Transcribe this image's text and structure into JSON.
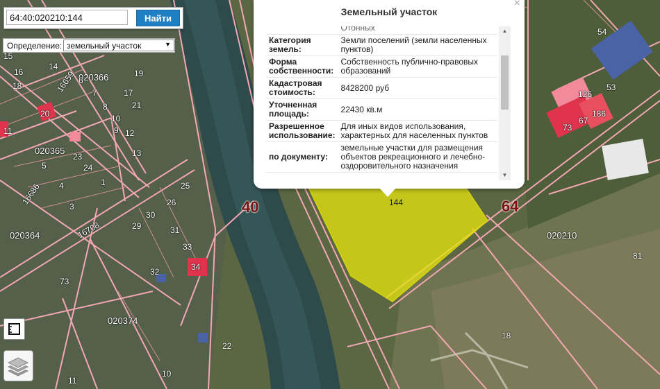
{
  "search": {
    "value": "64:40:020210:144",
    "button_label": "Найти"
  },
  "definition": {
    "label": "Определение:",
    "selected": "земельный участок"
  },
  "popup": {
    "title": "Земельный участок",
    "close": "×",
    "truncated_top": "Отонных",
    "rows": [
      {
        "key": "Категория земель:",
        "value": "Земли поселений (земли населенных пунктов)"
      },
      {
        "key": "Форма собственности:",
        "value": "Собственность публично-правовых образований"
      },
      {
        "key": "Кадастровая стоимость:",
        "value": "8428200 руб"
      },
      {
        "key": "Уточненная площадь:",
        "value": "22430 кв.м"
      },
      {
        "key": "Разрешенное использование:",
        "value": "Для иных видов использования, характерных для населенных пунктов"
      },
      {
        "key": "по документу:",
        "value": "земельные участки для размещения объектов рекреационного и лечебно-оздоровительного назначения"
      }
    ]
  },
  "map": {
    "highlight_color": "#e7e60e",
    "boundary_color": "#f2a7b3",
    "labels": {
      "parcel_144": "144",
      "district_40": "40",
      "district_64": "64",
      "block_020366": "020366",
      "block_020365": "020365",
      "block_020364": "020364",
      "block_020374": "020374",
      "block_020210": "020210",
      "n54": "54",
      "n53": "53",
      "n126": "126",
      "n67": "67",
      "n186": "186",
      "n73a": "73",
      "n81": "81",
      "n18": "18",
      "n22": "22",
      "n10": "10",
      "n11": "11",
      "n73": "73",
      "n33": "33",
      "n34": "34",
      "n31": "31",
      "n23": "23",
      "n8": "8",
      "n7": "7",
      "n6": "6",
      "n5": "5",
      "n4": "4",
      "n3": "3",
      "n1": "1",
      "n9": "9",
      "n10b": "10",
      "n12": "12",
      "n13": "13",
      "n15": "15",
      "n16": "16",
      "n19": "19",
      "n21": "21",
      "n20": "20",
      "n14": "14",
      "n24": "24",
      "n25": "25",
      "n26": "26",
      "n29": "29",
      "n30": "30",
      "n32": "32",
      "n18b": "18",
      "n17": "17",
      "n11b": "11",
      "street_16659": "16659",
      "street_16686": "16686",
      "street_16708": "16708"
    }
  },
  "tools": {
    "ruler_icon": "ruler-icon",
    "layers_icon": "layers-icon"
  }
}
